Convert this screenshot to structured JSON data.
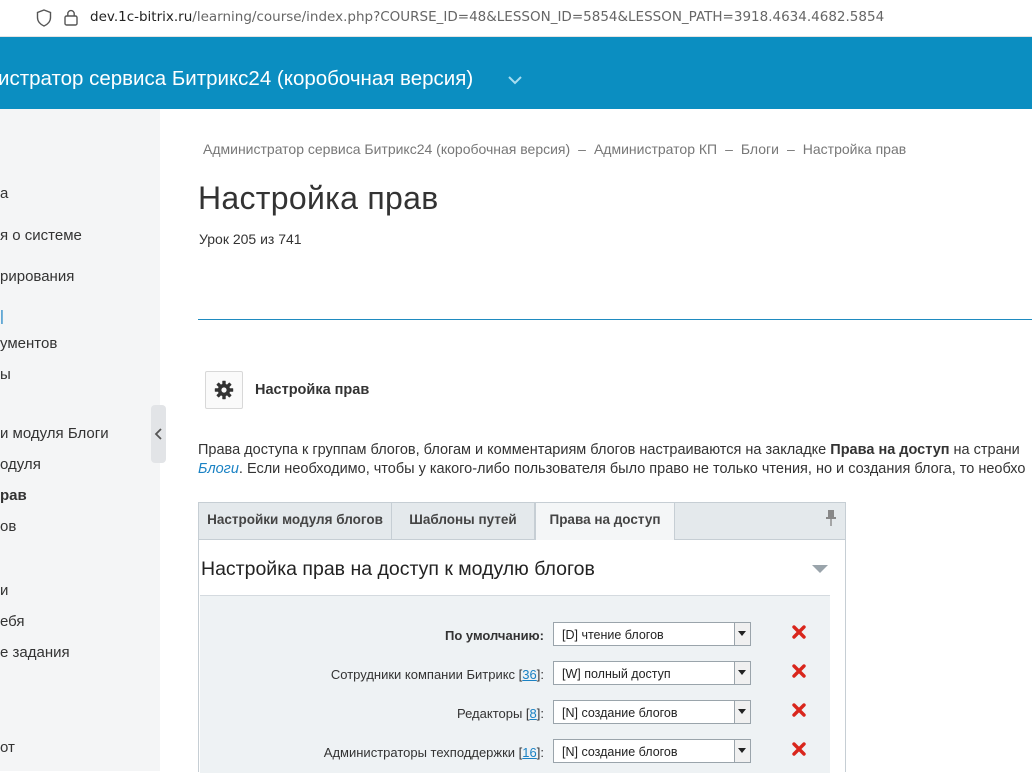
{
  "browser": {
    "url_domain": "dev.1c-bitrix.ru",
    "url_path": "/learning/course/index.php?COURSE_ID=48&LESSON_ID=5854&LESSON_PATH=3918.4634.4682.5854"
  },
  "header": {
    "title": "истратор сервиса Битрикс24 (коробочная версия)"
  },
  "sidebar": {
    "items": [
      {
        "label": "а"
      },
      {
        "label": "я о системе"
      },
      {
        "label": "рирования"
      },
      {
        "label": "|"
      },
      {
        "label": "ументов"
      },
      {
        "label": "ы"
      },
      {
        "label": "и модуля Блоги"
      },
      {
        "label": "одуля"
      },
      {
        "label": "рав"
      },
      {
        "label": "ов"
      },
      {
        "label": "и"
      },
      {
        "label": "ебя"
      },
      {
        "label": "е задания"
      },
      {
        "label": "от"
      }
    ]
  },
  "breadcrumb": {
    "items": [
      "Администратор сервиса Битрикс24 (коробочная версия)",
      "Администратор КП",
      "Блоги",
      "Настройка прав"
    ],
    "separator": "–"
  },
  "page": {
    "title": "Настройка прав",
    "lesson": "Урок 205 из 741"
  },
  "settings_block": {
    "label": "Настройка прав",
    "icon": "gear-icon"
  },
  "description": {
    "line1_prefix": "Права доступа к группам блогов, блогам и комментариям блогов настраиваются на закладке ",
    "line1_bold": "Права на доступ",
    "line1_suffix": " на страни",
    "line2_link": "Блоги",
    "line2_suffix": ". Если необходимо, чтобы у какого-либо пользователя было право не только чтения, но и создания блога, то необхо"
  },
  "panel": {
    "tabs": [
      {
        "label": "Настройки модуля блогов"
      },
      {
        "label": "Шаблоны путей"
      },
      {
        "label": "Права на доступ"
      }
    ],
    "section_title": "Настройка прав на доступ к модулю блогов",
    "rows": [
      {
        "label": "По умолчанию:",
        "count": "",
        "suffix": "",
        "value": "[D] чтение блогов"
      },
      {
        "label": "Сотрудники компании Битрикс [",
        "count": "36",
        "suffix": "]:",
        "value": "[W] полный доступ"
      },
      {
        "label": "Редакторы [",
        "count": "8",
        "suffix": "]:",
        "value": "[N] создание блогов"
      },
      {
        "label": "Администраторы техподдержки [",
        "count": "16",
        "suffix": "]:",
        "value": "[N] создание блогов"
      }
    ]
  },
  "colors": {
    "header_bg": "#0b8ec1",
    "link": "#1a82c4",
    "delete": "#d9261c"
  }
}
